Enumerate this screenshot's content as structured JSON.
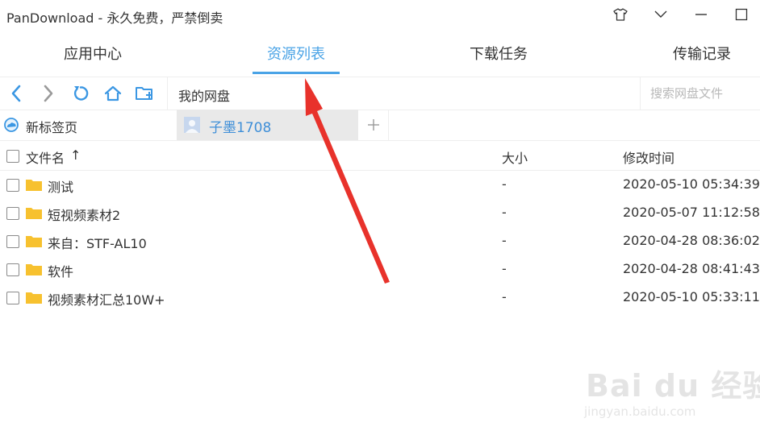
{
  "window": {
    "title": "PanDownload - 永久免费，严禁倒卖"
  },
  "tabs": [
    {
      "label": "应用中心",
      "active": false
    },
    {
      "label": "资源列表",
      "active": true
    },
    {
      "label": "下载任务",
      "active": false
    },
    {
      "label": "传输记录",
      "active": false
    }
  ],
  "toolbar": {
    "path": "我的网盘",
    "search_placeholder": "搜索网盘文件"
  },
  "bookmarks": {
    "new_tab": "新标签页",
    "account": "子墨1708"
  },
  "file_table": {
    "headers": {
      "name": "文件名",
      "sort": "↑",
      "size": "大小",
      "modified": "修改时间"
    },
    "rows": [
      {
        "name": "测试",
        "size": "-",
        "modified": "2020-05-10 05:34:39"
      },
      {
        "name": "短视频素材2",
        "size": "-",
        "modified": "2020-05-07 11:12:58"
      },
      {
        "name": "来自：STF-AL10",
        "size": "-",
        "modified": "2020-04-28 08:36:02"
      },
      {
        "name": "软件",
        "size": "-",
        "modified": "2020-04-28 08:41:43"
      },
      {
        "name": "视频素材汇总10W+",
        "size": "-",
        "modified": "2020-05-10 05:33:11"
      }
    ]
  },
  "watermark": {
    "brand": "Bai du 经验",
    "url": "jingyan.baidu.com"
  },
  "colors": {
    "accent": "#4aa3e6",
    "folder": "#f7c12f",
    "annotation_arrow": "#e8322b"
  },
  "icons": [
    "back-arrow-icon",
    "forward-arrow-icon",
    "refresh-icon",
    "home-icon",
    "new-folder-icon",
    "shirt-skin-icon",
    "chevron-down-icon",
    "minimize-icon",
    "maximize-icon",
    "cloud-icon",
    "avatar-icon",
    "plus-icon",
    "folder-icon"
  ]
}
